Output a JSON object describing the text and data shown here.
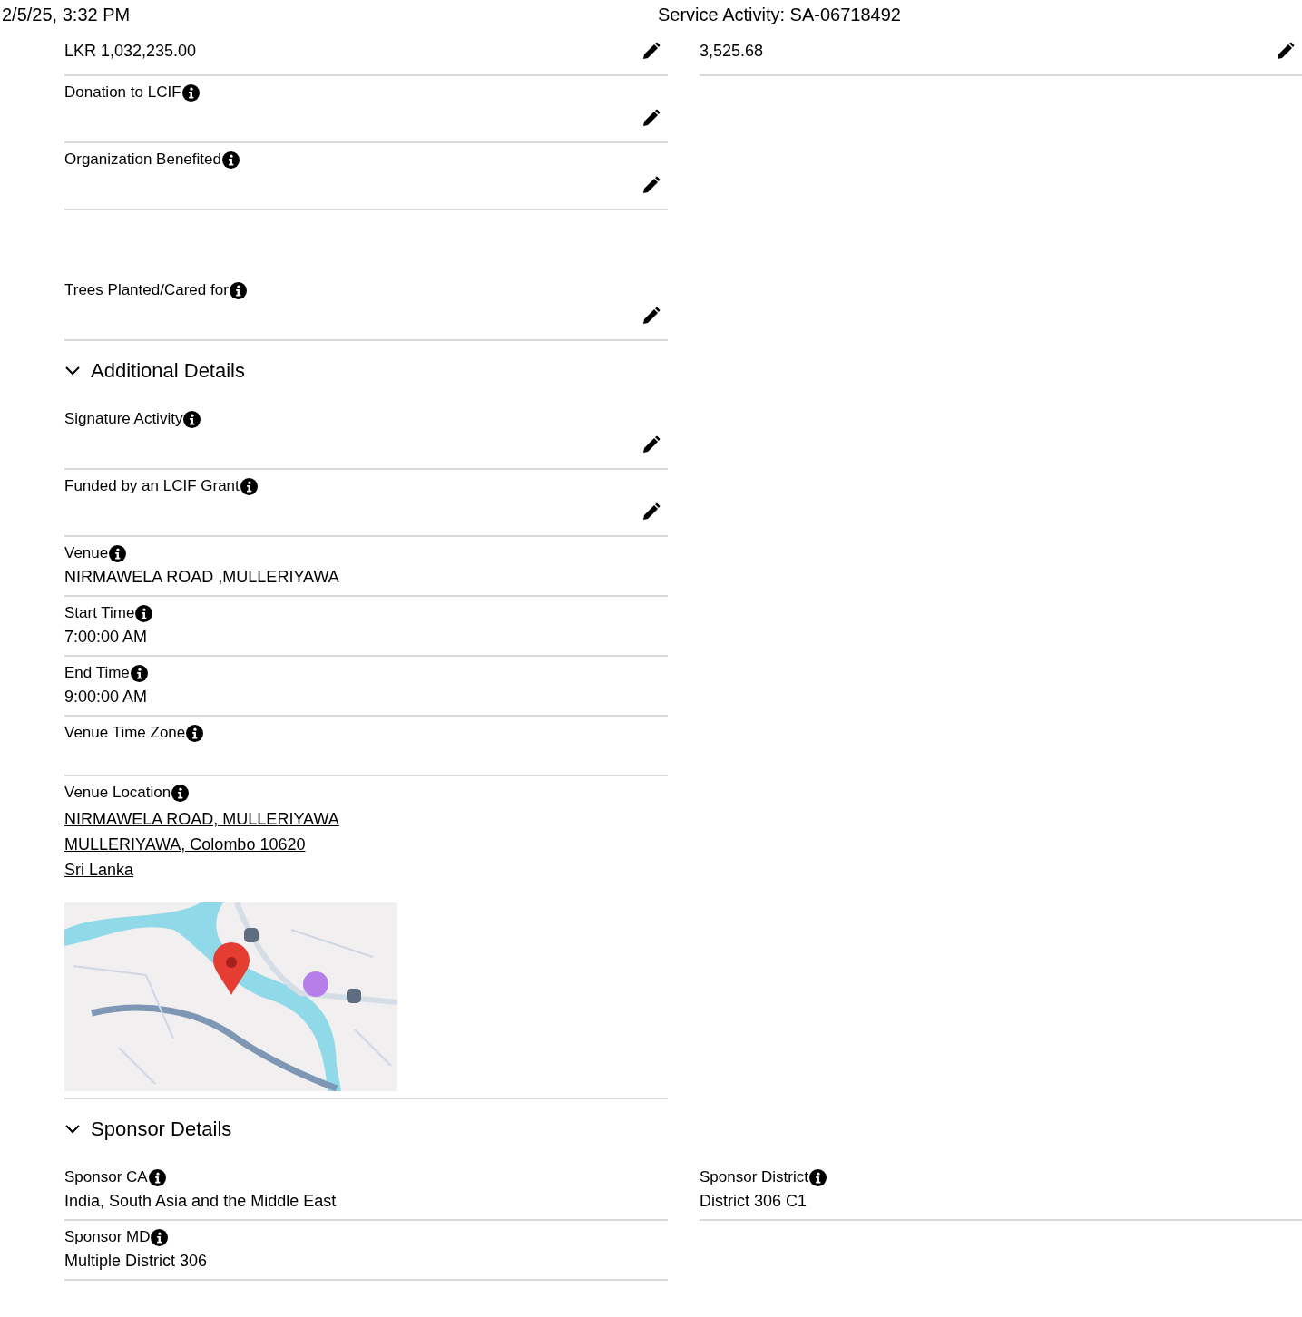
{
  "header": {
    "date": "2/5/25, 3:32 PM",
    "title": "Service Activity: SA-06718492"
  },
  "sections": [
    {
      "rows": [
        {
          "kind": "fields",
          "cells": [
            {
              "kind": "text",
              "value": "LKR 1,032,235.00",
              "editable": true
            },
            {
              "kind": "text",
              "value": "3,525.68",
              "editable": true
            }
          ]
        },
        {
          "kind": "fields",
          "cells": [
            {
              "kind": "text",
              "label": "Donation to LCIF",
              "info": true,
              "editable": true
            }
          ]
        },
        {
          "kind": "fields",
          "cells": [
            {
              "kind": "text",
              "label": "Organization Benefited",
              "info": true,
              "editable": true
            }
          ]
        },
        {
          "kind": "blank"
        },
        {
          "kind": "fields",
          "cells": [
            {
              "kind": "text",
              "label": "Trees Planted/Cared for",
              "info": true,
              "editable": true
            }
          ]
        }
      ]
    },
    {
      "title": "Additional Details",
      "expanded": true,
      "rows": [
        {
          "kind": "fields",
          "cells": [
            {
              "kind": "text",
              "label": "Signature Activity",
              "info": true,
              "editable": true
            }
          ]
        },
        {
          "kind": "fields",
          "cells": [
            {
              "kind": "text",
              "label": "Funded by an LCIF Grant",
              "info": true,
              "editable": true
            }
          ]
        },
        {
          "kind": "fields",
          "cells": [
            {
              "kind": "text",
              "label": "Venue",
              "info": true,
              "value": "NIRMAWELA ROAD ,MULLERIYAWA",
              "editable": false
            }
          ]
        },
        {
          "kind": "fields",
          "cells": [
            {
              "kind": "text",
              "label": "Start Time",
              "info": true,
              "value": "7:00:00 AM",
              "editable": false
            }
          ]
        },
        {
          "kind": "fields",
          "cells": [
            {
              "kind": "text",
              "label": "End Time",
              "info": true,
              "value": "9:00:00 AM",
              "editable": false
            }
          ]
        },
        {
          "kind": "fields",
          "cells": [
            {
              "kind": "text",
              "label": "Venue Time Zone",
              "info": true,
              "editable": false
            }
          ]
        },
        {
          "kind": "fields",
          "cells": [
            {
              "kind": "address",
              "label": "Venue Location",
              "info": true,
              "lines": [
                "NIRMAWELA ROAD, MULLERIYAWA",
                "MULLERIYAWA, Colombo 10620",
                "Sri Lanka"
              ],
              "editable": false
            }
          ]
        }
      ]
    },
    {
      "title": "Sponsor Details",
      "expanded": true,
      "rows": [
        {
          "kind": "fields",
          "cells": [
            {
              "kind": "text",
              "label": "Sponsor CA",
              "info": true,
              "value": "India, South Asia and the Middle East",
              "editable": false
            },
            {
              "kind": "text",
              "label": "Sponsor District",
              "info": true,
              "value": "District 306 C1",
              "editable": false
            }
          ]
        },
        {
          "kind": "fields",
          "cells": [
            {
              "kind": "text",
              "label": "Sponsor MD",
              "info": true,
              "value": "Multiple District 306",
              "editable": false
            }
          ]
        }
      ]
    }
  ]
}
